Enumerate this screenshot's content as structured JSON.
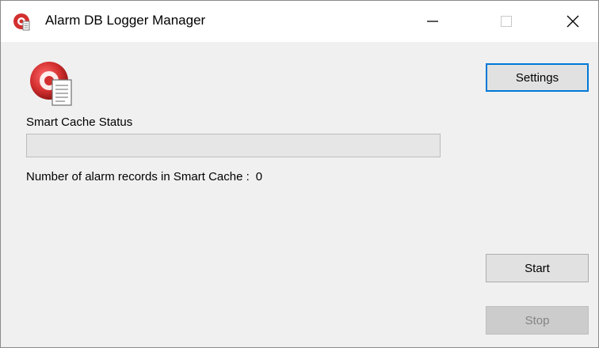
{
  "window": {
    "title": "Alarm DB Logger Manager",
    "icon": "alarm-bell-icon",
    "controls": {
      "minimize": "minimize-icon",
      "maximize": "maximize-icon",
      "close": "close-icon"
    }
  },
  "main": {
    "app_icon": "alarm-log-icon",
    "status_label": "Smart Cache Status",
    "progress": 0,
    "records_label": "Number of alarm records in Smart Cache :",
    "records_value": "0"
  },
  "buttons": {
    "settings": "Settings",
    "start": "Start",
    "stop": "Stop"
  },
  "colors": {
    "accent": "#0078d7",
    "client_bg": "#f0f0f0",
    "icon_red": "#d32f2f"
  }
}
